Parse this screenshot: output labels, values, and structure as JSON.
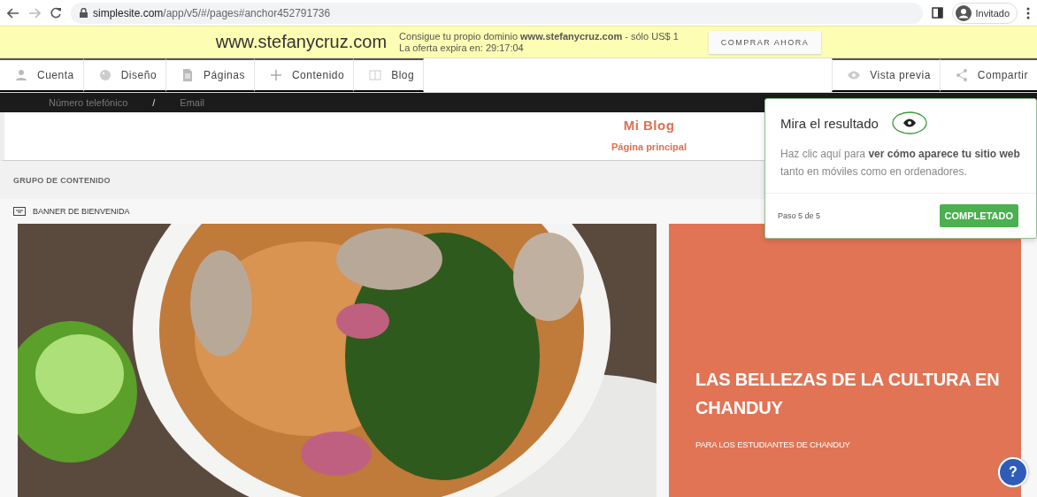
{
  "browser": {
    "url_host": "simplesite.com",
    "url_path": "/app/v5/#/pages#anchor452791736",
    "profile": "Invitado"
  },
  "promo": {
    "domain": "www.stefanycruz.com",
    "message": "Consigue tu propio dominio **www.stefanycruz.com** - sólo US$ 1",
    "expiry": "La oferta expira en: 29:17:04",
    "button": "COMPRAR AHORA"
  },
  "toolbar": {
    "left": [
      {
        "kind": "user",
        "label": "Cuenta"
      },
      {
        "kind": "palette",
        "label": "Diseño"
      },
      {
        "kind": "page",
        "label": "Páginas"
      },
      {
        "kind": "plus",
        "label": "Contenido"
      },
      {
        "kind": "book",
        "label": "Blog"
      }
    ],
    "right": [
      {
        "kind": "eye",
        "label": "Vista previa"
      },
      {
        "kind": "share",
        "label": "Compartir"
      }
    ]
  },
  "contact_bar": {
    "phone": "Número telefónico",
    "separator": "/",
    "email": "Email"
  },
  "site_header": {
    "title": "Mi Blog",
    "nav": "Página principal"
  },
  "content_group": {
    "label": "GRUPO DE CONTENIDO"
  },
  "banner": {
    "label": "BANNER DE BIENVENIDA",
    "heading": "LAS BELLEZAS DE LA CULTURA EN CHANDUY",
    "subheading": "PARA LOS ESTUDIANTES DE CHANDUY"
  },
  "tour": {
    "title": "Mira el resultado",
    "body": "Haz clic aquí para **ver cómo aparece tu sitio web** tanto en móviles como en ordenadores.",
    "step": "Paso 5 de 5",
    "button": "COMPLETADO"
  },
  "help": {
    "label": "?"
  }
}
